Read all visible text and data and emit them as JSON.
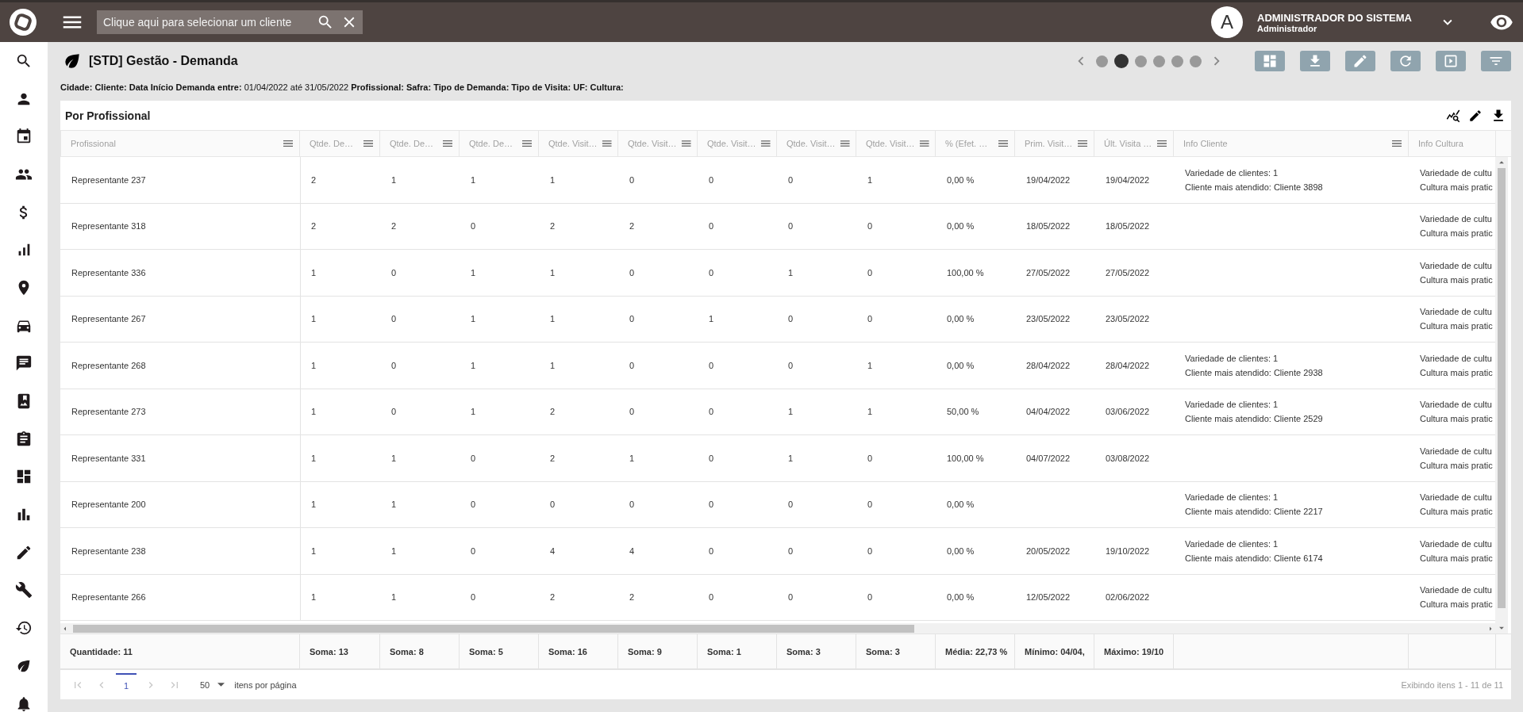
{
  "top_bar": {
    "search": {
      "placeholder": "Clique aqui para selecionar um cliente"
    },
    "user": {
      "initial": "A",
      "name": "ADMINISTRADOR DO SISTEMA",
      "role": "Administrador"
    }
  },
  "page": {
    "title": "[STD] Gestão - Demanda",
    "filters": "**Cidade: Cliente: Data Início Demanda entre:** 01/04/2022 até 31/05/2022 **Profissional: Safra: Tipo de Demanda: Tipo de Visita: UF: Cultura:**",
    "carousel": [
      {
        "selected": false
      },
      {
        "selected": true
      },
      {
        "selected": false
      },
      {
        "selected": false
      },
      {
        "selected": false
      },
      {
        "selected": false
      }
    ]
  },
  "card": {
    "title": "Por Profissional",
    "columns": [
      "Profissional",
      "Qtde. De…",
      "Qtde. De…",
      "Qtde. De…",
      "Qtde. Visit…",
      "Qtde. Visit…",
      "Qtde. Visit…",
      "Qtde. Visit…",
      "Qtde. Visit…",
      "% (Efet. …",
      "Prim. Visit…",
      "Últ. Visita …",
      "Info Cliente",
      "Info Cultura"
    ],
    "rows": [
      {
        "cells": [
          "Representante 237",
          "2",
          "1",
          "1",
          "1",
          "0",
          "0",
          "0",
          "1",
          "0,00 %",
          "19/04/2022",
          "19/04/2022"
        ],
        "info_cliente": [
          "Variedade de clientes: 1",
          "Cliente mais atendido: Cliente 3898"
        ],
        "info_cultura": [
          "Variedade de cultu",
          "Cultura mais pratic"
        ]
      },
      {
        "cells": [
          "Representante 318",
          "2",
          "2",
          "0",
          "2",
          "2",
          "0",
          "0",
          "0",
          "0,00 %",
          "18/05/2022",
          "18/05/2022"
        ],
        "info_cultura": [
          "Variedade de cultu",
          "Cultura mais pratic"
        ]
      },
      {
        "cells": [
          "Representante 336",
          "1",
          "0",
          "1",
          "1",
          "0",
          "0",
          "1",
          "0",
          "100,00 %",
          "27/05/2022",
          "27/05/2022"
        ],
        "info_cultura": [
          "Variedade de cultu",
          "Cultura mais pratic"
        ]
      },
      {
        "cells": [
          "Representante 267",
          "1",
          "0",
          "1",
          "1",
          "0",
          "1",
          "0",
          "0",
          "0,00 %",
          "23/05/2022",
          "23/05/2022"
        ],
        "info_cultura": [
          "Variedade de cultu",
          "Cultura mais pratic"
        ]
      },
      {
        "cells": [
          "Representante 268",
          "1",
          "0",
          "1",
          "1",
          "0",
          "0",
          "0",
          "1",
          "0,00 %",
          "28/04/2022",
          "28/04/2022"
        ],
        "info_cliente": [
          "Variedade de clientes: 1",
          "Cliente mais atendido: Cliente 2938"
        ],
        "info_cultura": [
          "Variedade de cultu",
          "Cultura mais pratic"
        ]
      },
      {
        "cells": [
          "Representante 273",
          "1",
          "0",
          "1",
          "2",
          "0",
          "0",
          "1",
          "1",
          "50,00 %",
          "04/04/2022",
          "03/06/2022"
        ],
        "info_cliente": [
          "Variedade de clientes: 1",
          "Cliente mais atendido: Cliente 2529"
        ],
        "info_cultura": [
          "Variedade de cultu",
          "Cultura mais pratic"
        ]
      },
      {
        "cells": [
          "Representante 331",
          "1",
          "1",
          "0",
          "2",
          "1",
          "0",
          "1",
          "0",
          "100,00 %",
          "04/07/2022",
          "03/08/2022"
        ],
        "info_cultura": [
          "Variedade de cultu",
          "Cultura mais pratic"
        ]
      },
      {
        "cells": [
          "Representante 200",
          "1",
          "1",
          "0",
          "0",
          "0",
          "0",
          "0",
          "0",
          "0,00 %",
          null,
          null
        ],
        "info_cliente": [
          "Variedade de clientes: 1",
          "Cliente mais atendido: Cliente 2217"
        ],
        "info_cultura": [
          "Variedade de cultu",
          "Cultura mais pratic"
        ]
      },
      {
        "cells": [
          "Representante 238",
          "1",
          "1",
          "0",
          "4",
          "4",
          "0",
          "0",
          "0",
          "0,00 %",
          "20/05/2022",
          "19/10/2022"
        ],
        "info_cliente": [
          "Variedade de clientes: 1",
          "Cliente mais atendido: Cliente 6174"
        ],
        "info_cultura": [
          "Variedade de cultu",
          "Cultura mais pratic"
        ]
      },
      {
        "cells": [
          "Representante 266",
          "1",
          "1",
          "0",
          "2",
          "2",
          "0",
          "0",
          "0",
          "0,00 %",
          "12/05/2022",
          "02/06/2022"
        ],
        "info_cultura": [
          "Variedade de cultu",
          "Cultura mais pratic"
        ]
      }
    ],
    "totals": [
      "Quantidade: 11",
      "Soma: 13",
      "Soma: 8",
      "Soma: 5",
      "Soma: 16",
      "Soma: 9",
      "Soma: 1",
      "Soma: 3",
      "Soma: 3",
      "Média: 22,73 %",
      "Mínimo: 04/04,",
      "Máximo: 19/10"
    ],
    "pager": {
      "nav": [
        {
          "kind": "first",
          "disabled": true
        },
        {
          "kind": "prev",
          "disabled": true
        },
        {
          "kind": "page",
          "label": "1",
          "selected": true
        },
        {
          "kind": "next",
          "disabled": true
        },
        {
          "kind": "last",
          "disabled": true
        }
      ],
      "page_size": "50",
      "page_size_label": "itens por página",
      "summary": "Exibindo itens 1 - 11 de 11"
    }
  }
}
